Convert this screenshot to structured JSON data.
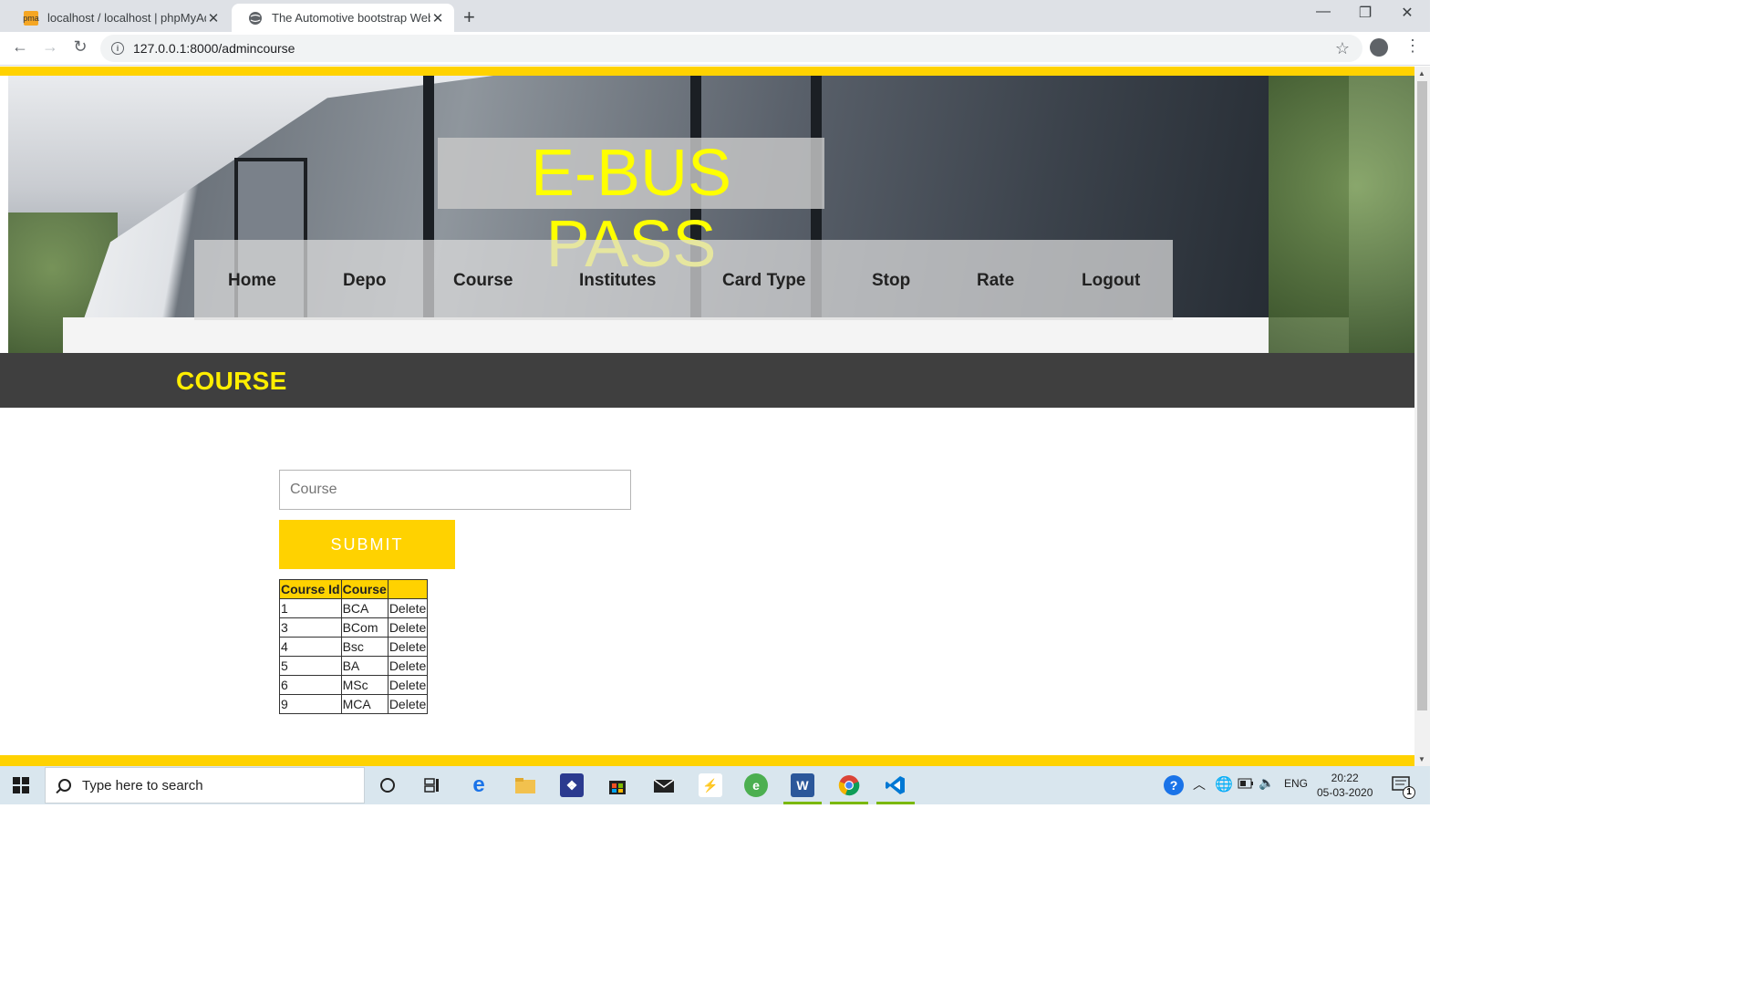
{
  "browser": {
    "tabs": [
      {
        "title": "localhost / localhost | phpMyAdmin",
        "active": false
      },
      {
        "title": "The Automotive bootstrap Website",
        "active": true
      }
    ],
    "url": "127.0.0.1:8000/admincourse"
  },
  "site": {
    "brand": "E-BUS PASS",
    "nav": [
      "Home",
      "Depo",
      "Course",
      "Institutes",
      "Card Type",
      "Stop",
      "Rate",
      "Logout"
    ],
    "page_heading": "COURSE"
  },
  "form": {
    "course_placeholder": "Course",
    "submit_label": "SUBMIT"
  },
  "table": {
    "headers": [
      "Course Id",
      "Course",
      ""
    ],
    "rows": [
      {
        "id": "1",
        "course": "BCA",
        "action": "Delete"
      },
      {
        "id": "3",
        "course": "BCom",
        "action": "Delete"
      },
      {
        "id": "4",
        "course": "Bsc",
        "action": "Delete"
      },
      {
        "id": "5",
        "course": "BA",
        "action": "Delete"
      },
      {
        "id": "6",
        "course": "MSc",
        "action": "Delete"
      },
      {
        "id": "9",
        "course": "MCA",
        "action": "Delete"
      }
    ]
  },
  "taskbar": {
    "search_placeholder": "Type here to search",
    "language": "ENG",
    "time": "20:22",
    "date": "05-03-2020",
    "notification_count": "1"
  },
  "colors": {
    "accent_yellow": "#ffd200",
    "brand_text": "#ffff00",
    "heading_bar": "#3f3f3f"
  }
}
